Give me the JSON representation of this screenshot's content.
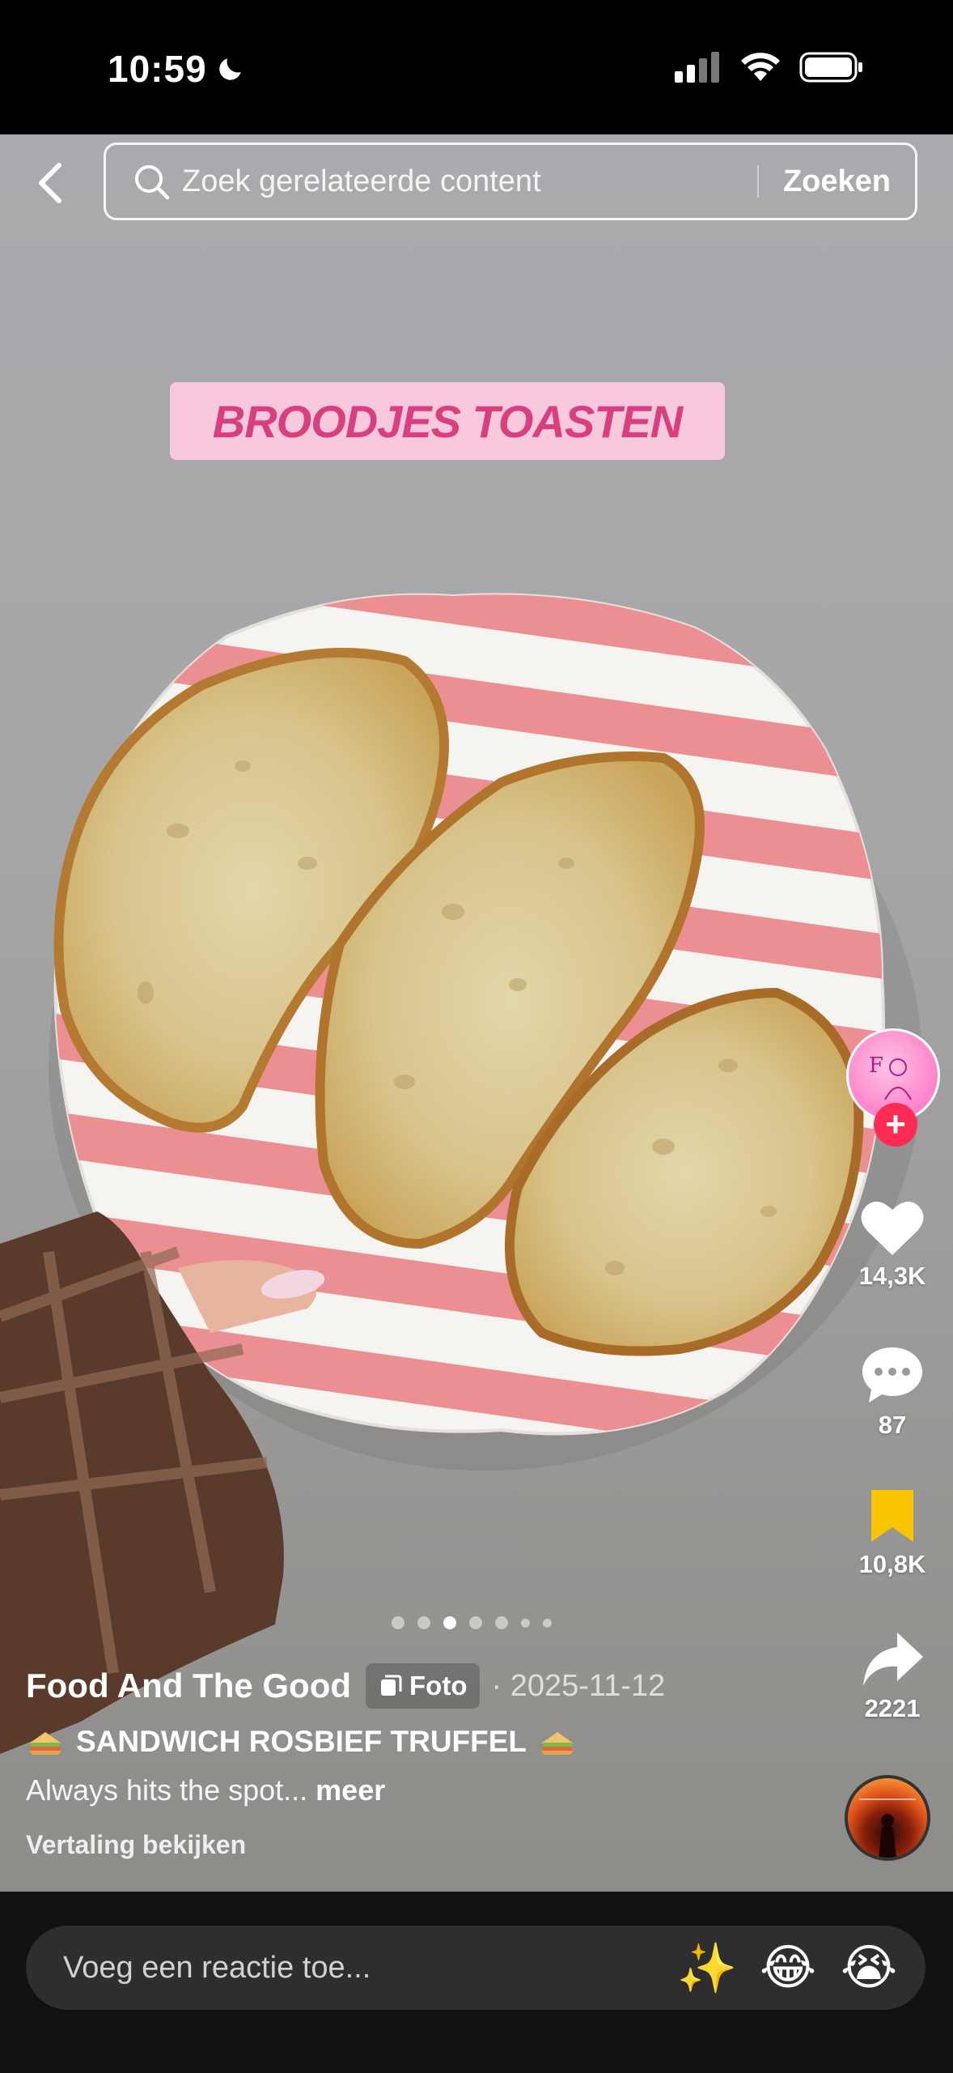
{
  "status_bar": {
    "time": "10:59"
  },
  "search": {
    "placeholder": "Zoek gerelateerde content",
    "submit_label": "Zoeken"
  },
  "post": {
    "title_overlay": "BROODJES TOASTEN",
    "author": "Food And The Good",
    "type_badge": "Foto",
    "date": "· 2025-11-12",
    "caption_title": "SANDWICH ROSBIEF TRUFFEL",
    "caption_text": "Always hits the spot...",
    "more_label": "meer",
    "translate_label": "Vertaling bekijken",
    "carousel": {
      "count": 7,
      "active_index": 2
    }
  },
  "actions": {
    "likes": "14,3K",
    "comments": "87",
    "saves": "10,8K",
    "shares": "2221"
  },
  "comment_bar": {
    "placeholder": "Voeg een reactie toe...",
    "emojis": [
      "✨",
      "😂",
      "😭"
    ]
  },
  "colors": {
    "title_banner_bg": "#f8c9dc",
    "title_banner_text": "#d93f7e",
    "save_icon": "#f9c500",
    "follow_button": "#fe2c55"
  }
}
